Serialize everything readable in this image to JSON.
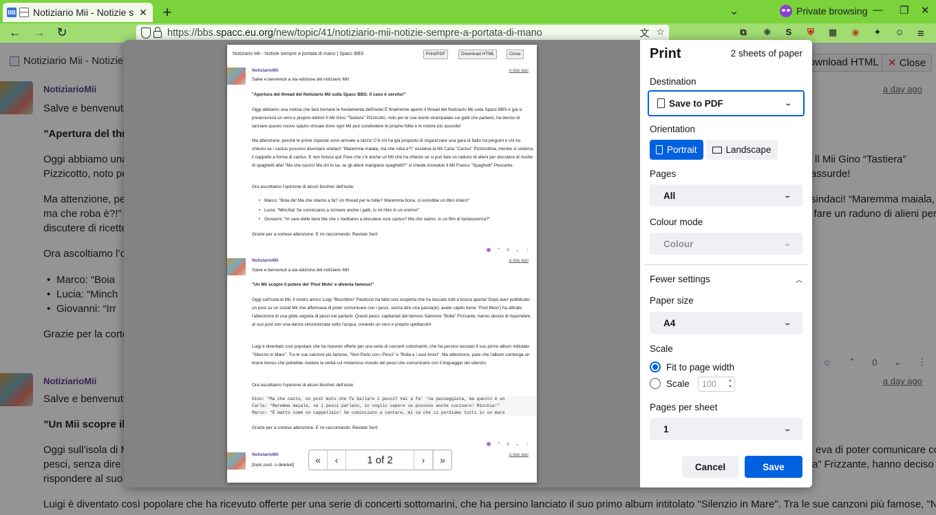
{
  "browser": {
    "tab_title": "Notiziario Mii - Notizie se",
    "tab_favicon_text": "BB",
    "tab_close": "✕",
    "new_tab": "+",
    "tabs_list": "⌄",
    "private_label": "Private browsing",
    "minimize": "—",
    "restore": "❐",
    "close": "✕",
    "back": "←",
    "forward": "→",
    "reload": "↻",
    "url_prefix": "https://bbs.",
    "url_host": "spacc.eu.org",
    "url_path": "/new/topic/41/notiziario-mii-notizie-sempre-a-portata-di-mano",
    "menu": "≡",
    "extension_badge": "2"
  },
  "page": {
    "title": "Notiziario Mii - Notizie s",
    "download_html": "Download HTML",
    "close": "Close",
    "post1": {
      "author": "NotiziarioMii",
      "time": "a day ago",
      "greeting": "Salve e benvenuti a",
      "headline": "”Apertura del thr",
      "p1a": "Oggi abbiamo una",
      "p1b": "Pizzicotto, noto per",
      "p1c": "ll Mii Gino “Tastiera”",
      "p1d": "assurde!",
      "p2a": "Ma attenzione, per",
      "p2b": "ma che roba è?!” e",
      "p2c": "discutere di ricette",
      "p2d": "sindaci! “Maremma maiala,",
      "p2e": "o fare un raduno di alieni per",
      "p3": "Ora ascoltiamo l’op",
      "b1": "Marco: “Boia",
      "b2": "Lucia: “Minch",
      "b3": "Giovanni: “Irr",
      "thanks": "Grazie per la corte",
      "votes": "0"
    },
    "post2": {
      "author": "NotiziarioMii",
      "time": "a day ago",
      "greeting": "Salve e benvenuti a",
      "headline": "”Un Mii scopre il",
      "p1a": "Oggi sull’isola di M",
      "p1b": "pesci, senza dire u",
      "p1c": "rispondere al suo p",
      "p1d": "eva di poter comunicare con i",
      "p1e": "a” Frizzante, hanno deciso di",
      "p2": "Luigi è diventato così popolare che ha ricevuto offerte per una serie di concerti sottomarini, che ha persino lanciato il suo primo album intitolato \"Silenzio in Mare\". Tra le sue canzoni più famose, \"Non Parlo con i"
    }
  },
  "preview": {
    "header": "Notiziario Mii - Notizie sempre a portata di mano | Spacc BBS",
    "print_pdf": "Print/PDF",
    "download_html": "Download HTML",
    "close": "Close",
    "post1": {
      "author": "NotiziarioMii",
      "time": "a day ago",
      "greeting": "Salve e benvenuti a sta edizione del notiziario Mii!",
      "headline": "\"Apertura del thread del Notiziario Mii sulla Spacc BBS: Il caos è servito!\"",
      "p1": "Oggi abbiamo una notizia che farà tremare le fondamenta dell'isola! È finalmente aperto il thread del Notiziario Mii sulla Spacc BBS e già si preannuncia un vero e proprio delirio! Il Mii Gino \"Tastiera\" Pizzicotto, noto per le sue teorie strampalate sui gatti che parlano, ha deciso di lanciare questo nuovo spazio virtuale dove ogni Mii può condividere le proprie follie e le notizie più assurde!",
      "p2": "Ma attenzione, perché le prime risposte sono arrivate a razzo! C'è chi ha già proposto di organizzare una gara di ballo tra pinguini e chi ha chiesto se i cactus possono diventare sindaci! \"Maremma maiala, ma che roba è?!\" esclama la Mii Carla \"Cactus\" Pizzicottina, mentre si sistema il cappello a forma di cactus. E non finisce qui! Pare che c'è anche un Mii che ha chiesto se si può fare un raduno di alieni per discutere di ricette di spaghetti alla! \"Ma che cazzo! Ma chi lo sa, se gli alieni mangiano spaghetti?\" si chiede incredulo il Mii Franco \"Spaghetti\" Pescante.",
      "p3": "Ora ascoltiamo l'opinione di alcuni bischeri dell'isola:",
      "b1": "Marco: \"Boia dè! Ma che stiamo a fa? Un thread per le follie? Maremma bona, ci vorrebbe un libro intero!\"",
      "b2": "Lucia: \"Minchia! Se cominciano a scrivere anche i gatti, io mi ritiro in un eremo!\"",
      "b3": "Giovanni: \"Irr sare delle bere Ma che c mettiamo a discutere coni cactus? Ma che siamo, in un film di fantascienza?\"",
      "thanks": "Grazie per a cortese attenzione. E mi raccomando: Restate Seri!",
      "votes": "0"
    },
    "post2": {
      "author": "NotiziarioMii",
      "time": "a day ago",
      "greeting": "Salve e benvenuti a sta edizione del notiziario Mii!",
      "headline": "\"Un Mii scopre il potere del 'Post Muto' e diventa famoso!\"",
      "p1": "Oggi sull'isola di Mii, il nostro amico Luigi \"Biscottino\" Pasticcio ha fatto una scoperta che ha lasciato tutti a bocca aperta! Dopo aver pubblicato un post su un social Mii che affermava di poter comunicare con i pesci, senza dire una parola(e), avete capito bene: 'Post Muto') ha attirato l'attenzione di una gilda segreta di pesci nei parlanti. Questi pesci, capitanati dal famoso Salmone \"Bolla\" Frizzante, hanno deciso di rispondere al suo post con una danza sincronizzata sotto l'acqua, creando un vero e proprio spettacolo!",
      "p2": "Luigi è diventato così popolare che ha ricevuto offerte per una serie di concerti sottomarini, che ha persino lanciato il suo primo album intitolato \"Silenzio in Mare\". Tra le sue canzoni più famose, \"Non Parlo con i Pesci\" e \"Bolla e i suoi Amici\". Ma attenzione, pare che l'album contenga un brano bonus che potrebbe rivelare la verità sul misterioso mondo dei pesci che comunicano con il linguaggio del silenzio.",
      "p3": "Ora ascoltiamo l'opinione di alcuni bischeri dell'isola:",
      "code": "Gino: \"Ma che cazzo, un post muto che fa ballare i pesci? Vai a fa' 'na passeggiata, ma questo è un\nCarla: \"Maremma maiala, se i pesci parlano, io voglio sapere se possono anche cucinare! Minchia!\"\nMarco: \"È matto come un cappellaio! Se cominciano a cantare, mi sa che ci perdiamo tutti in un mare",
      "thanks": "Grazie per a cortese attenzione. E mi raccomando: Restate Seri!",
      "votes": "0"
    },
    "post3": {
      "author": "NotiziarioMii",
      "time": "a day ago",
      "text": "[topic post- s-deleted]",
      "votes": "0"
    },
    "pager": {
      "first": "«",
      "prev": "‹",
      "info": "1 of 2",
      "next": "›",
      "last": "»"
    }
  },
  "print": {
    "title": "Print",
    "sheets": "2 sheets of paper",
    "destination_label": "Destination",
    "destination_value": "Save to PDF",
    "orientation_label": "Orientation",
    "portrait": "Portrait",
    "landscape": "Landscape",
    "pages_label": "Pages",
    "pages_value": "All",
    "colour_label": "Colour mode",
    "colour_value": "Colour",
    "fewer_settings": "Fewer settings",
    "paper_label": "Paper size",
    "paper_value": "A4",
    "scale_label": "Scale",
    "fit_label": "Fit to page width",
    "scale_option": "Scale",
    "scale_value": "100",
    "pps_label": "Pages per sheet",
    "pps_value": "1",
    "cancel": "Cancel",
    "save": "Save",
    "accent_color": "#0061e0"
  }
}
